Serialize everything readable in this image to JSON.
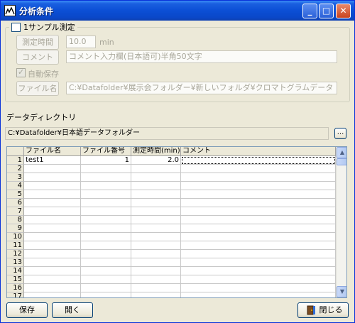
{
  "window": {
    "title": "分析条件"
  },
  "sample_group": {
    "checkbox_label": "1サンプル測定",
    "checked": false,
    "measure_time_button": "測定時間",
    "measure_time_value": "10.0",
    "measure_time_unit": "min",
    "comment_button": "コメント",
    "comment_value": "コメント入力欄(日本語可)半角50文字",
    "autosave_label": "自動保存",
    "autosave_checked": true,
    "filename_button": "ファイル名",
    "filename_value": "C:¥Datafolder¥展示会フォルダー¥新しいフォルダ¥クロマトグラムデータ"
  },
  "data_directory": {
    "label": "データディレクトリ",
    "path": "C:¥Datafolder¥日本語データフォルダー",
    "browse_button": "..."
  },
  "table": {
    "columns": [
      "ファイル名",
      "ファイル番号",
      "測定時間(min)",
      "コメント"
    ],
    "rows": [
      {
        "num": "1",
        "filename": "test1",
        "file_number": "1",
        "time": "2.0",
        "comment": ""
      },
      {
        "num": "2",
        "filename": "",
        "file_number": "",
        "time": "",
        "comment": ""
      },
      {
        "num": "3",
        "filename": "",
        "file_number": "",
        "time": "",
        "comment": ""
      },
      {
        "num": "4",
        "filename": "",
        "file_number": "",
        "time": "",
        "comment": ""
      },
      {
        "num": "5",
        "filename": "",
        "file_number": "",
        "time": "",
        "comment": ""
      },
      {
        "num": "6",
        "filename": "",
        "file_number": "",
        "time": "",
        "comment": ""
      },
      {
        "num": "7",
        "filename": "",
        "file_number": "",
        "time": "",
        "comment": ""
      },
      {
        "num": "8",
        "filename": "",
        "file_number": "",
        "time": "",
        "comment": ""
      },
      {
        "num": "9",
        "filename": "",
        "file_number": "",
        "time": "",
        "comment": ""
      },
      {
        "num": "10",
        "filename": "",
        "file_number": "",
        "time": "",
        "comment": ""
      },
      {
        "num": "11",
        "filename": "",
        "file_number": "",
        "time": "",
        "comment": ""
      },
      {
        "num": "12",
        "filename": "",
        "file_number": "",
        "time": "",
        "comment": ""
      },
      {
        "num": "13",
        "filename": "",
        "file_number": "",
        "time": "",
        "comment": ""
      },
      {
        "num": "14",
        "filename": "",
        "file_number": "",
        "time": "",
        "comment": ""
      },
      {
        "num": "15",
        "filename": "",
        "file_number": "",
        "time": "",
        "comment": ""
      },
      {
        "num": "16",
        "filename": "",
        "file_number": "",
        "time": "",
        "comment": ""
      },
      {
        "num": "17",
        "filename": "",
        "file_number": "",
        "time": "",
        "comment": ""
      }
    ]
  },
  "footer": {
    "save_button": "保存",
    "open_button": "開く",
    "close_button": "閉じる"
  }
}
